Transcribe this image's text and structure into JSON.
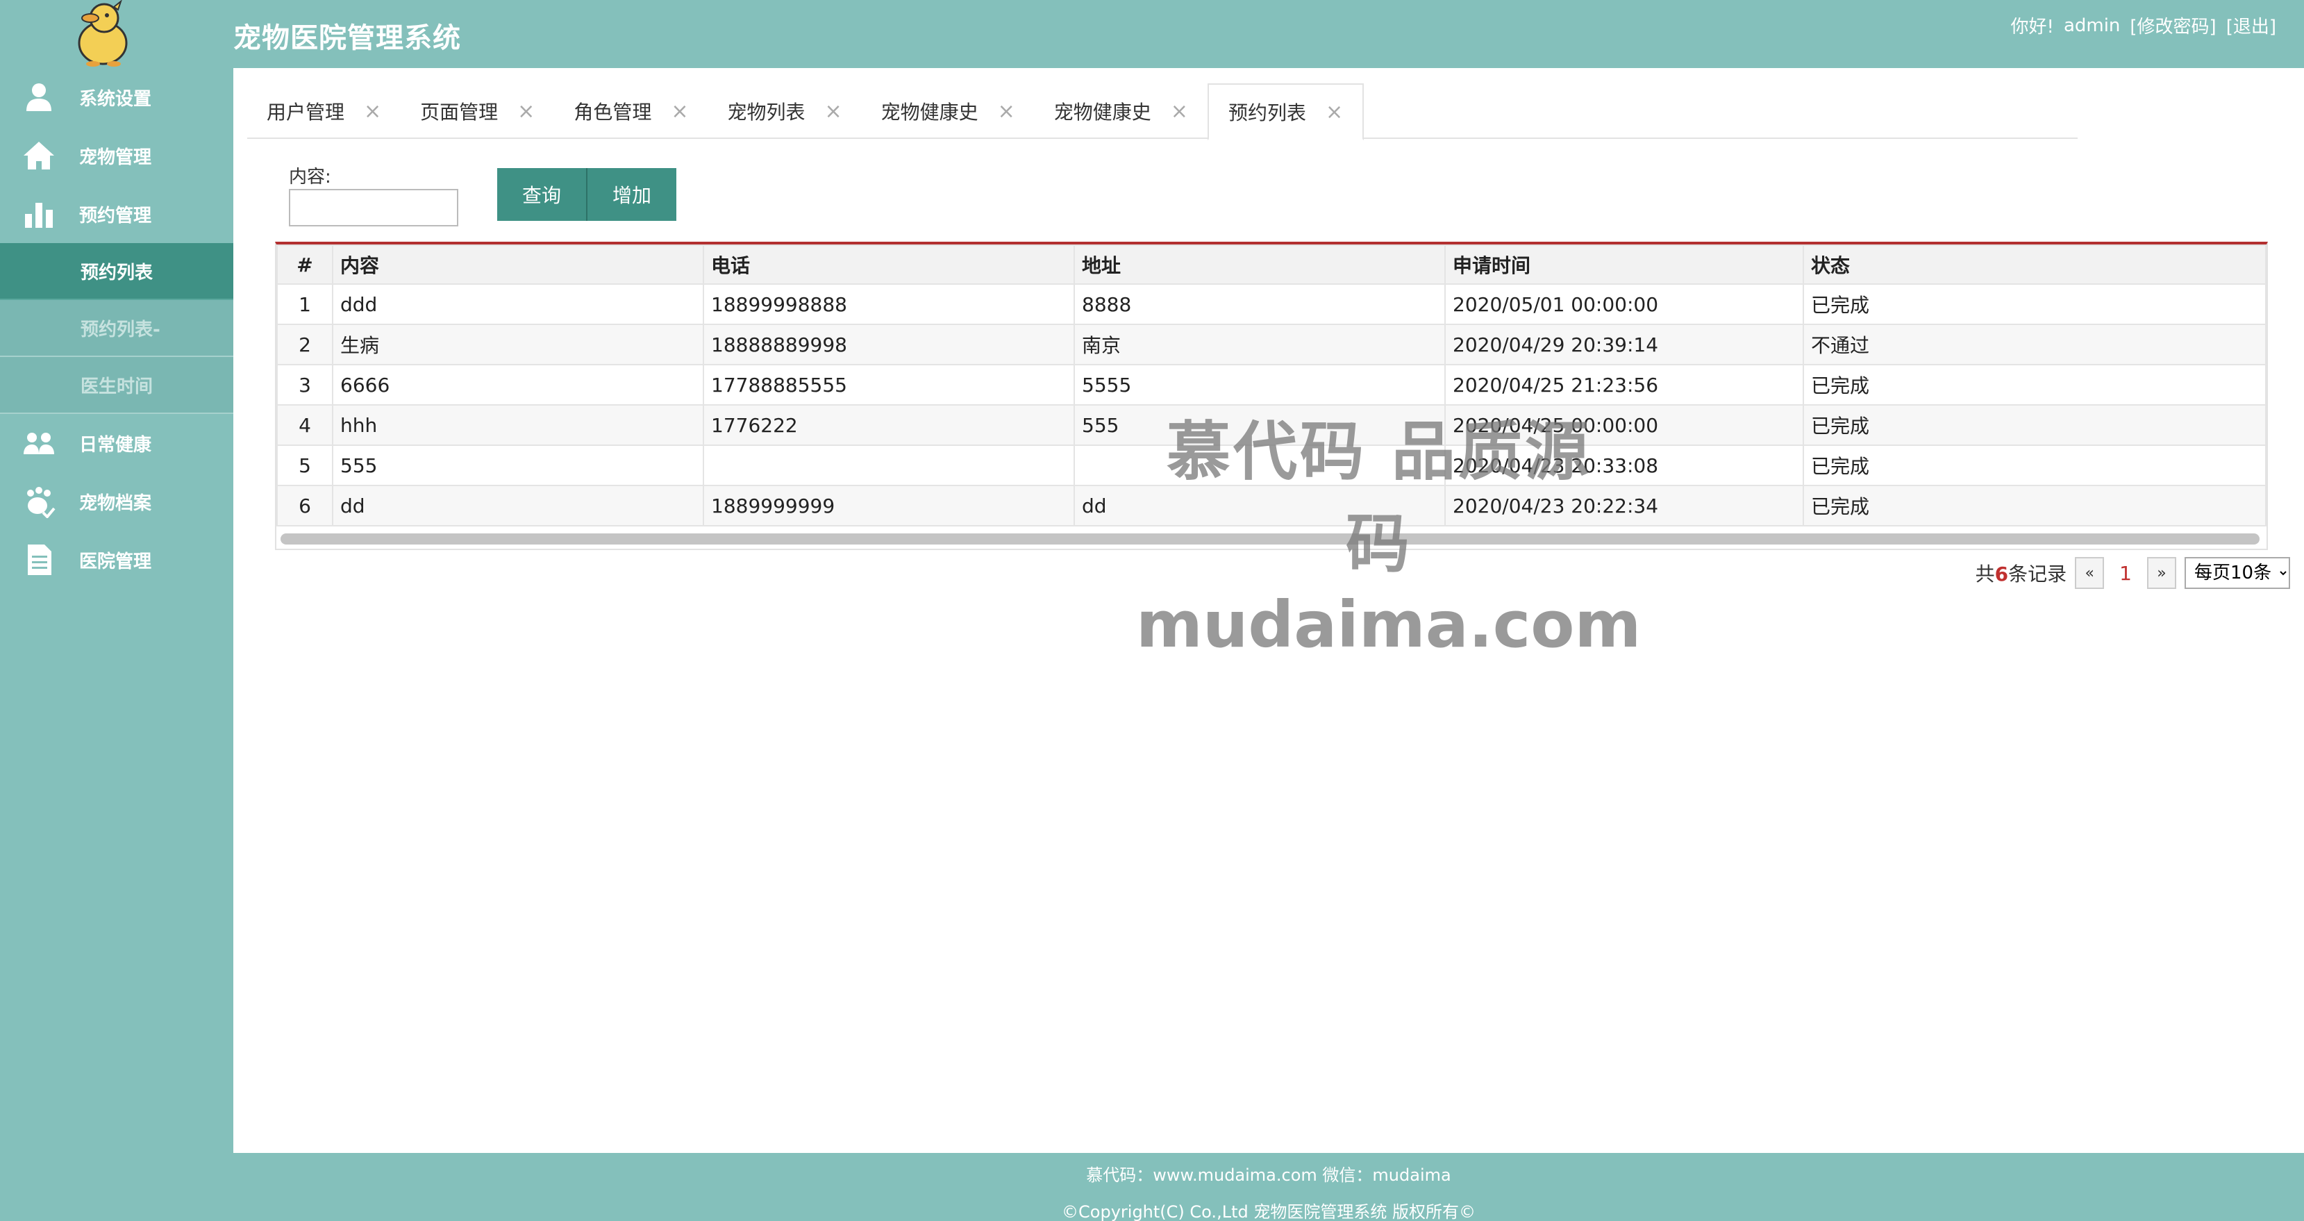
{
  "header": {
    "title": "宠物医院管理系统",
    "greeting": "你好!",
    "username": "admin",
    "change_password": "[修改密码]",
    "logout": "[退出]"
  },
  "sidebar": {
    "items": [
      {
        "label": "系统设置",
        "icon": "user-icon"
      },
      {
        "label": "宠物管理",
        "icon": "home-icon"
      },
      {
        "label": "预约管理",
        "icon": "bar-chart-icon"
      }
    ],
    "submenu": [
      {
        "label": "预约列表",
        "active": true
      },
      {
        "label": "预约列表-",
        "active": false
      },
      {
        "label": "医生时间",
        "active": false
      }
    ],
    "items_after": [
      {
        "label": "日常健康",
        "icon": "group-icon"
      },
      {
        "label": "宠物档案",
        "icon": "paw-check-icon"
      },
      {
        "label": "医院管理",
        "icon": "document-icon"
      }
    ]
  },
  "tabs": [
    {
      "label": "用户管理",
      "close": "×"
    },
    {
      "label": "页面管理",
      "close": "×"
    },
    {
      "label": "角色管理",
      "close": "×"
    },
    {
      "label": "宠物列表",
      "close": "×"
    },
    {
      "label": "宠物健康史",
      "close": "×"
    },
    {
      "label": "宠物健康史",
      "close": "×"
    },
    {
      "label": "预约列表",
      "close": "×",
      "active": true
    }
  ],
  "search": {
    "label": "内容:",
    "value": "",
    "query_button": "查询",
    "add_button": "增加"
  },
  "table": {
    "columns": [
      "#",
      "内容",
      "电话",
      "地址",
      "申请时间",
      "状态"
    ],
    "rows": [
      [
        "1",
        "ddd",
        "18899998888",
        "8888",
        "2020/05/01 00:00:00",
        "已完成"
      ],
      [
        "2",
        "生病",
        "18888889998",
        "南京",
        "2020/04/29 20:39:14",
        "不通过"
      ],
      [
        "3",
        "6666",
        "17788885555",
        "5555",
        "2020/04/25 21:23:56",
        "已完成"
      ],
      [
        "4",
        "hhh",
        "1776222",
        "555",
        "2020/04/25 00:00:00",
        "已完成"
      ],
      [
        "5",
        "555",
        "",
        "",
        "2020/04/23 20:33:08",
        "已完成"
      ],
      [
        "6",
        "dd",
        "1889999999",
        "dd",
        "2020/04/23 20:22:34",
        "已完成"
      ]
    ]
  },
  "pager": {
    "prefix": "共",
    "count": "6",
    "suffix": "条记录",
    "prev": "«",
    "page": "1",
    "next": "»",
    "per_page": "每页10条"
  },
  "watermark": {
    "line1": "慕代码 品质源码",
    "line2": "mudaima.com"
  },
  "footer": {
    "line1": "慕代码：www.mudaima.com 微信：mudaima",
    "line2": "©Copyright(C) Co.,Ltd 宠物医院管理系统 版权所有©"
  },
  "colors": {
    "theme": "#84c0bb",
    "accent": "#3f9185",
    "table_top_border": "#b33030"
  }
}
